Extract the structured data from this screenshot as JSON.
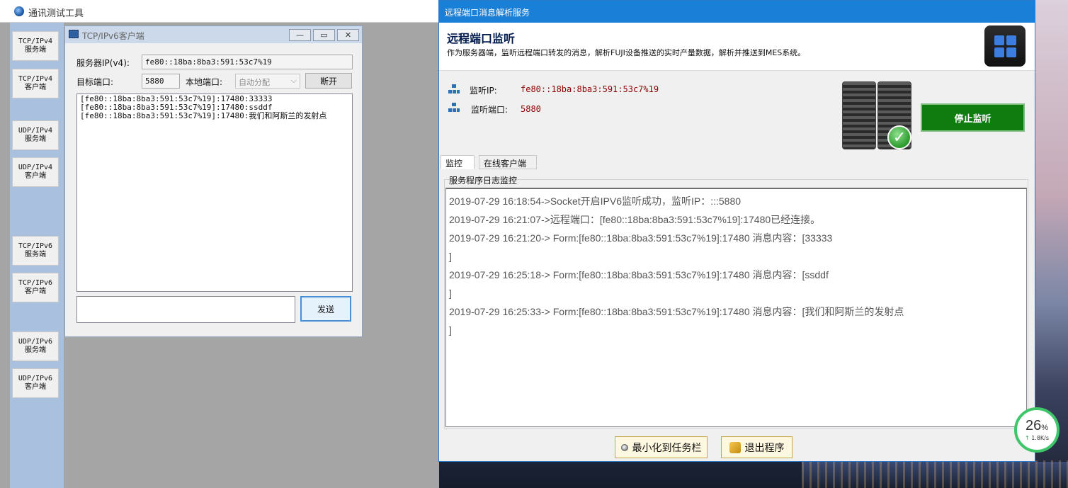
{
  "main_window": {
    "title": "通讯测试工具",
    "side_buttons": [
      {
        "line1": "TCP/IPv4",
        "line2": "服务端"
      },
      {
        "line1": "TCP/IPv4",
        "line2": "客户端"
      },
      {
        "line1": "UDP/IPv4",
        "line2": "服务端"
      },
      {
        "line1": "UDP/IPv4",
        "line2": "客户端"
      },
      {
        "line1": "TCP/IPv6",
        "line2": "服务端"
      },
      {
        "line1": "TCP/IPv6",
        "line2": "客户端"
      },
      {
        "line1": "UDP/IPv6",
        "line2": "服务端"
      },
      {
        "line1": "UDP/IPv6",
        "line2": "客户端"
      }
    ]
  },
  "client_window": {
    "title": "TCP/IPv6客户端",
    "server_ip_label": "服务器IP(v4):",
    "server_ip_value": "fe80::18ba:8ba3:591:53c7%19",
    "target_port_label": "目标端口:",
    "target_port_value": "5880",
    "local_port_label": "本地端口:",
    "local_port_value": "自动分配",
    "disconnect_label": "断开",
    "messages": [
      "[fe80::18ba:8ba3:591:53c7%19]:17480:33333",
      "[fe80::18ba:8ba3:591:53c7%19]:17480:ssddf",
      "[fe80::18ba:8ba3:591:53c7%19]:17480:我们和阿斯兰的发射点"
    ],
    "send_label": "发送"
  },
  "service_window": {
    "title": "远程端口消息解析服务",
    "header_title": "远程端口监听",
    "header_desc": "作为服务器端，监听远程端口转发的消息，解析FUJI设备推送的实时产量数据，解析并推送到MES系统。",
    "listen_ip_label": "监听IP:",
    "listen_ip_value": "fe80::18ba:8ba3:591:53c7%19",
    "listen_port_label": "监听端口:",
    "listen_port_value": "5880",
    "stop_label": "停止监听",
    "tabs": [
      "监控",
      "在线客户端"
    ],
    "log_group_title": "服务程序日志监控",
    "log_lines": [
      "2019-07-29 16:18:54->Socket开启IPV6监听成功，监听IP：:::5880",
      "2019-07-29 16:21:07->远程端口：[fe80::18ba:8ba3:591:53c7%19]:17480已经连接。",
      "2019-07-29 16:21:20-> Form:[fe80::18ba:8ba3:591:53c7%19]:17480 消息内容：[33333",
      "]",
      "2019-07-29 16:25:18-> Form:[fe80::18ba:8ba3:591:53c7%19]:17480 消息内容：[ssddf",
      "]",
      "2019-07-29 16:25:33-> Form:[fe80::18ba:8ba3:591:53c7%19]:17480 消息内容：[我们和阿斯兰的发射点",
      "]"
    ],
    "minimize_label": "最小化到任务栏",
    "exit_label": "退出程序"
  },
  "net_widget": {
    "percent": "26",
    "percent_unit": "%",
    "speed_arrow": "↑",
    "speed": "1.8K/s"
  }
}
